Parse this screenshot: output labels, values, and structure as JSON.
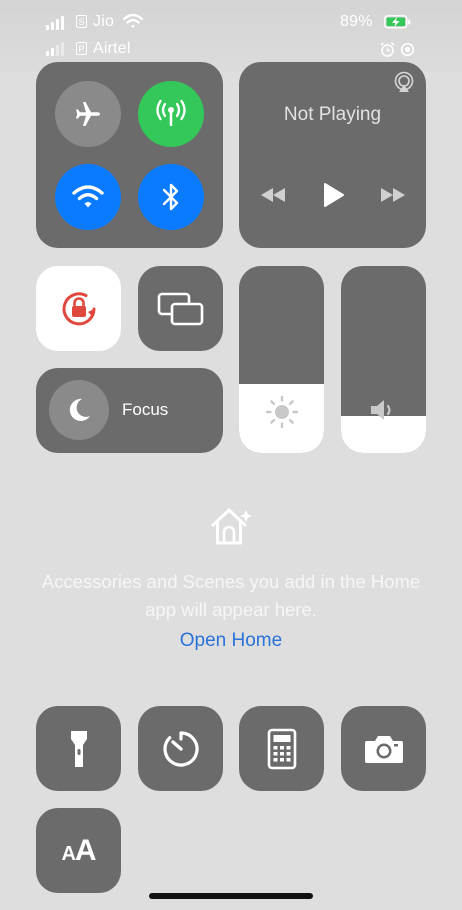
{
  "status_bar": {
    "carrier_1": "Jio",
    "carrier_2": "Airtel",
    "sim_1_badge": "S",
    "sim_2_badge": "P",
    "battery_percent": "89%",
    "battery_level": 0.89,
    "icons": [
      "signal-icon",
      "wifi-icon",
      "battery-charging-icon",
      "alarm-icon",
      "orientation-lock-icon"
    ]
  },
  "connectivity": {
    "airplane": {
      "icon": "airplane-icon",
      "on": false
    },
    "cellular": {
      "icon": "cellular-data-icon",
      "on": true,
      "color": "#34c759"
    },
    "wifi": {
      "icon": "wifi-icon",
      "on": true,
      "color": "#0a7aff"
    },
    "bluetooth": {
      "icon": "bluetooth-icon",
      "on": true,
      "color": "#0a7aff"
    }
  },
  "now_playing": {
    "status": "Not Playing",
    "icons": [
      "airplay-icon",
      "rewind-icon",
      "play-icon",
      "fast-forward-icon"
    ]
  },
  "orientation_lock": {
    "icon": "rotation-lock-icon",
    "on": true,
    "color": "#e0473d"
  },
  "screen_mirroring": {
    "icon": "screen-mirroring-icon"
  },
  "focus": {
    "label": "Focus",
    "icon": "moon-icon"
  },
  "brightness": {
    "icon": "sun-icon",
    "level": 0.37
  },
  "volume": {
    "icon": "speaker-icon",
    "level": 0.2
  },
  "home": {
    "icon": "home-icon",
    "message": "Accessories and Scenes you add in the Home app will appear here.",
    "open_link": "Open Home",
    "link_color": "#2a73d8"
  },
  "shortcuts": [
    {
      "icon": "flashlight-icon"
    },
    {
      "icon": "timer-icon"
    },
    {
      "icon": "calculator-icon"
    },
    {
      "icon": "camera-icon"
    },
    {
      "icon": "text-size-icon",
      "label": "AA"
    }
  ]
}
